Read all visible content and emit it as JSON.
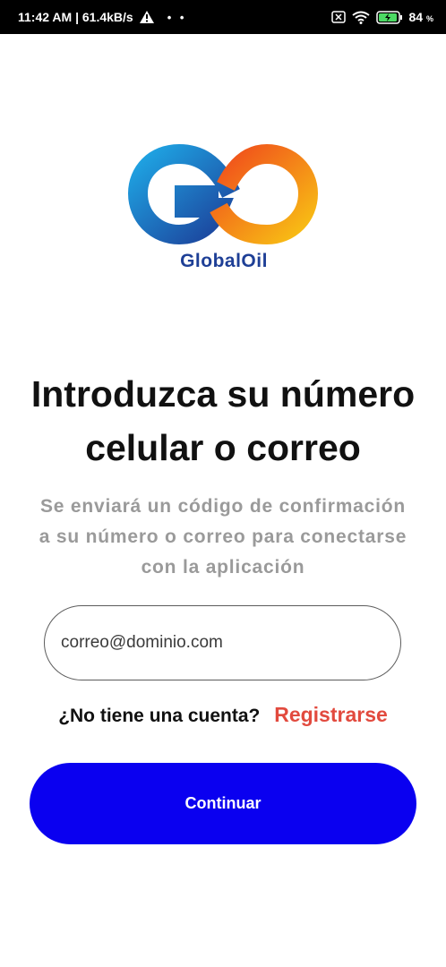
{
  "status_bar": {
    "time_speed": "11:42 AM | 61.4kB/s",
    "dots": "• •",
    "battery": "84",
    "battery_unit": "%"
  },
  "logo": {
    "brand_name": "GlobalOil",
    "colors": {
      "blue": "#1a8fd8",
      "dark_blue": "#1e3f96",
      "orange": "#f25a1c",
      "yellow": "#f8b515"
    }
  },
  "login": {
    "title_line1": "Introduzca su número",
    "title_line2": "celular o correo",
    "subtitle_line1": "Se enviará un código de confirmación",
    "subtitle_line2": "a su número o correo para conectarse",
    "subtitle_line3": "con la aplicación",
    "email_placeholder": "correo@dominio.com",
    "no_account": "¿No tiene una cuenta?",
    "register_link": "Registrarse",
    "continue_button": "Continuar"
  },
  "colors": {
    "accent_button": "#0a00f0",
    "link": "#e24a3e",
    "subtitle": "#9a9a9a"
  }
}
